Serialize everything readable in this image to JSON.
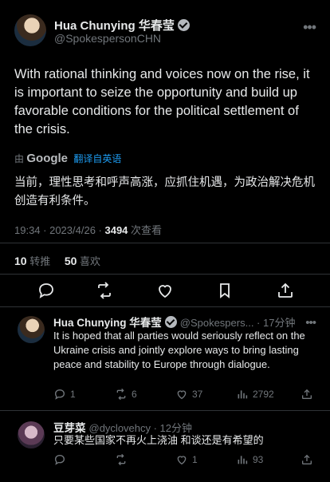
{
  "tweet": {
    "author_name": "Hua Chunying 华春莹",
    "author_handle": "@SpokespersonCHN",
    "text": "With rational thinking and voices now on the rise, it is important to seize the opportunity and build up favorable conditions for the political settlement of the crisis.",
    "translate_by": "由",
    "translate_provider": "Google",
    "translate_link": "翻译自英语",
    "translated_text": "当前，理性思考和呼声高涨，应抓住机遇，为政治解决危机创造有利条件。",
    "time": "19:34 · 2023/4/26 · ",
    "views_count": "3494",
    "views_label": " 次查看",
    "retweets_count": "10",
    "retweets_label": "转推",
    "likes_count": "50",
    "likes_label": "喜欢"
  },
  "actions": {
    "icons": [
      "reply-icon",
      "retweet-icon",
      "like-icon",
      "bookmark-icon",
      "share-icon"
    ]
  },
  "replies": [
    {
      "author_name": "Hua Chunying 华春莹",
      "author_handle": "@Spokespers... · 17分钟",
      "text": "It is hoped that all parties would seriously reflect on the Ukraine crisis and jointly explore ways to bring lasting peace and stability to Europe through dialogue.",
      "reply_count": "1",
      "retweet_count": "6",
      "like_count": "37",
      "view_count": "2792"
    },
    {
      "author_name": "豆芽菜",
      "author_handle": "@dyclovehcy · 12分钟",
      "text": "只要某些国家不再火上浇油 和谈还是有希望的",
      "reply_count": "",
      "retweet_count": "",
      "like_count": "1",
      "view_count": "93"
    }
  ],
  "colors": {
    "background": "#000000",
    "text": "#e7e9ea",
    "muted": "#71767b",
    "link": "#1d9bf0",
    "divider": "#2f3336"
  }
}
